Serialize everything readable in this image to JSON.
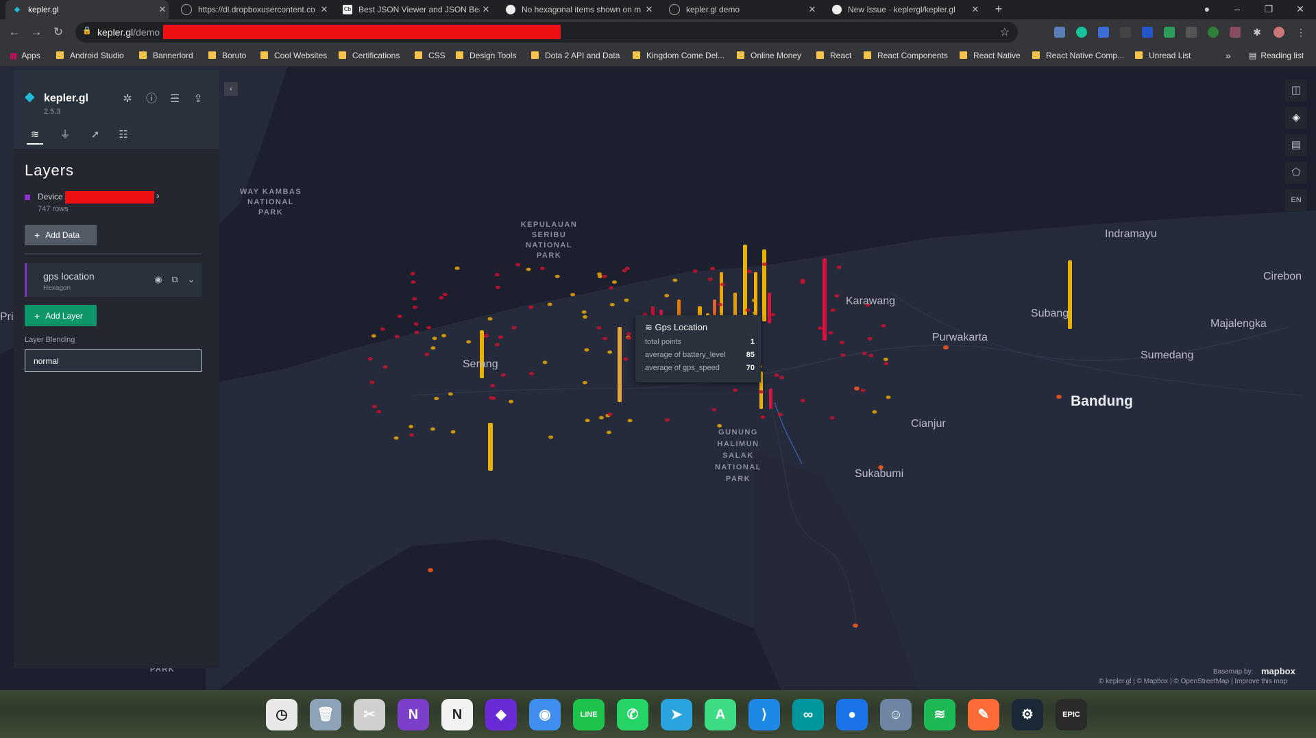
{
  "browser": {
    "tabs": [
      {
        "title": "kepler.gl",
        "icon": "kepler-icon"
      },
      {
        "title": "https://dl.dropboxusercontent.co",
        "icon": "globe-icon"
      },
      {
        "title": "Best JSON Viewer and JSON Bea",
        "icon": "cb-icon"
      },
      {
        "title": "No hexagonal items shown on m",
        "icon": "github-icon"
      },
      {
        "title": "kepler.gl demo",
        "icon": "globe-icon"
      },
      {
        "title": "New Issue · keplergl/kepler.gl",
        "icon": "github-icon"
      }
    ],
    "url_host": "kepler.gl",
    "url_path": "/demo",
    "bookmarks": [
      "Apps",
      "Android Studio",
      "Bannerlord",
      "Boruto",
      "Cool Websites",
      "Certifications",
      "CSS",
      "Design Tools",
      "Dota 2 API and Data",
      "Kingdom Come Del...",
      "Online Money",
      "React",
      "React Components",
      "React Native",
      "React Native Comp...",
      "Unread List"
    ],
    "reading_list": "Reading list",
    "more_bookmarks": "»"
  },
  "panel": {
    "app_name": "kepler.gl",
    "version": "2.5.3",
    "section_title": "Layers",
    "dataset_name": "Device",
    "dataset_rows": "747 rows",
    "add_data_label": "Add Data",
    "layer_name": "gps location",
    "layer_type": "Hexagon",
    "add_layer_label": "Add Layer",
    "blending_label": "Layer Blending",
    "blending_value": "normal"
  },
  "map_controls": {
    "locale": "EN"
  },
  "map_labels": {
    "park1": "WAY KAMBAS\nNATIONAL\nPARK",
    "park2": "KEPULAUAN\nSERIBU\nNATIONAL\nPARK",
    "park3": "GUNUNG\nHALIMUN\nSALAK\nNATIONAL\nPARK",
    "park4": "PARK",
    "cities": [
      {
        "name": "Indramayu",
        "big": false
      },
      {
        "name": "Cirebon",
        "big": false
      },
      {
        "name": "Karawang",
        "big": false
      },
      {
        "name": "Subang",
        "big": false
      },
      {
        "name": "Majalengka",
        "big": false
      },
      {
        "name": "Purwakarta",
        "big": false
      },
      {
        "name": "Sumedang",
        "big": false
      },
      {
        "name": "Bandung",
        "big": true
      },
      {
        "name": "Cianjur",
        "big": false
      },
      {
        "name": "Sukabumi",
        "big": false
      },
      {
        "name": "Serang",
        "big": false
      },
      {
        "name": "Pri",
        "big": false
      }
    ]
  },
  "tooltip": {
    "title": "Gps Location",
    "rows": [
      {
        "label": "total points",
        "value": "1"
      },
      {
        "label": "average of battery_level",
        "value": "85"
      },
      {
        "label": "average of gps_speed",
        "value": "70"
      }
    ]
  },
  "attribution": {
    "basemap_by": "Basemap by:",
    "mapbox": "mapbox",
    "credits": "© kepler.gl | © Mapbox | © OpenStreetMap | Improve this map"
  },
  "dock": [
    {
      "name": "clock",
      "color": "#e8e8e8",
      "glyph": "◷"
    },
    {
      "name": "trash",
      "color": "#8fa3b8",
      "glyph": "🗑"
    },
    {
      "name": "snipping-tool",
      "color": "#d0d0d0",
      "glyph": "✂"
    },
    {
      "name": "onenote",
      "color": "#7b3fc9",
      "glyph": "N"
    },
    {
      "name": "notion",
      "color": "#f2f2f2",
      "glyph": "N"
    },
    {
      "name": "prism",
      "color": "#6a2bd6",
      "glyph": "◆"
    },
    {
      "name": "chrome",
      "color": "#3f8ef0",
      "glyph": "◉"
    },
    {
      "name": "line",
      "color": "#1ec34b",
      "glyph": "LINE"
    },
    {
      "name": "whatsapp",
      "color": "#25d366",
      "glyph": "✆"
    },
    {
      "name": "telegram",
      "color": "#2aa3de",
      "glyph": "➤"
    },
    {
      "name": "android-studio",
      "color": "#3ddc84",
      "glyph": "A"
    },
    {
      "name": "vscode",
      "color": "#1e88e5",
      "glyph": "⟩"
    },
    {
      "name": "arduino",
      "color": "#00979c",
      "glyph": "∞"
    },
    {
      "name": "maps",
      "color": "#1a73e8",
      "glyph": "●"
    },
    {
      "name": "finder",
      "color": "#6e86a3",
      "glyph": "☺"
    },
    {
      "name": "spotify",
      "color": "#1db954",
      "glyph": "≋"
    },
    {
      "name": "postman",
      "color": "#ff6c37",
      "glyph": "✎"
    },
    {
      "name": "steam",
      "color": "#1b2838",
      "glyph": "⚙"
    },
    {
      "name": "epic-games",
      "color": "#2a2a2a",
      "glyph": "EPIC"
    }
  ]
}
